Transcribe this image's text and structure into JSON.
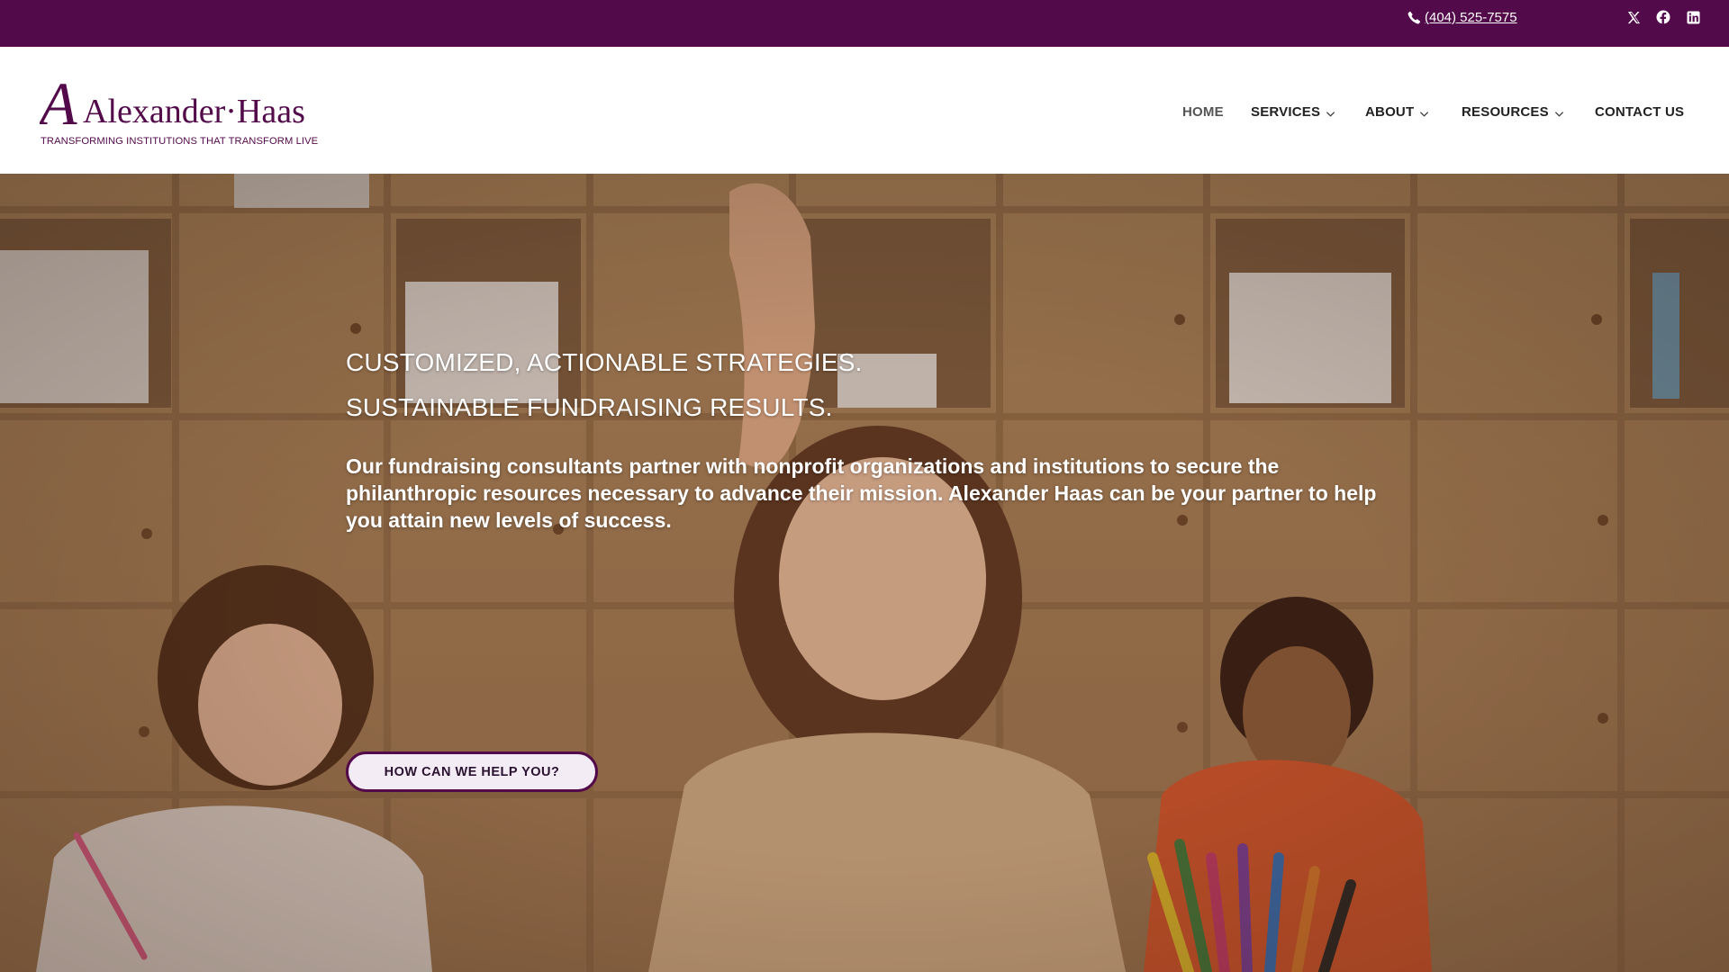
{
  "topbar": {
    "phone": "(404) 525-7575",
    "social": [
      {
        "name": "x-icon"
      },
      {
        "name": "facebook-icon"
      },
      {
        "name": "linkedin-icon"
      }
    ]
  },
  "logo": {
    "name": "Alexander·Haas",
    "tagline": "TRANSFORMING INSTITUTIONS THAT TRANSFORM LIVES"
  },
  "nav": {
    "home": "HOME",
    "services": "SERVICES",
    "about": "ABOUT",
    "resources": "RESOURCES",
    "contact": "CONTACT US"
  },
  "hero": {
    "heading_line1": "CUSTOMIZED, ACTIONABLE STRATEGIES.",
    "heading_line2": "SUSTAINABLE FUNDRAISING RESULTS.",
    "body": "Our fundraising consultants partner with nonprofit organizations and institutions to secure the philanthropic resources necessary to advance their mission. Alexander Haas can be your partner to help you attain new levels of success.",
    "cta": "HOW CAN WE HELP YOU?"
  },
  "colors": {
    "brand_purple": "#530a4b",
    "cta_bg": "#f3ecf5"
  }
}
